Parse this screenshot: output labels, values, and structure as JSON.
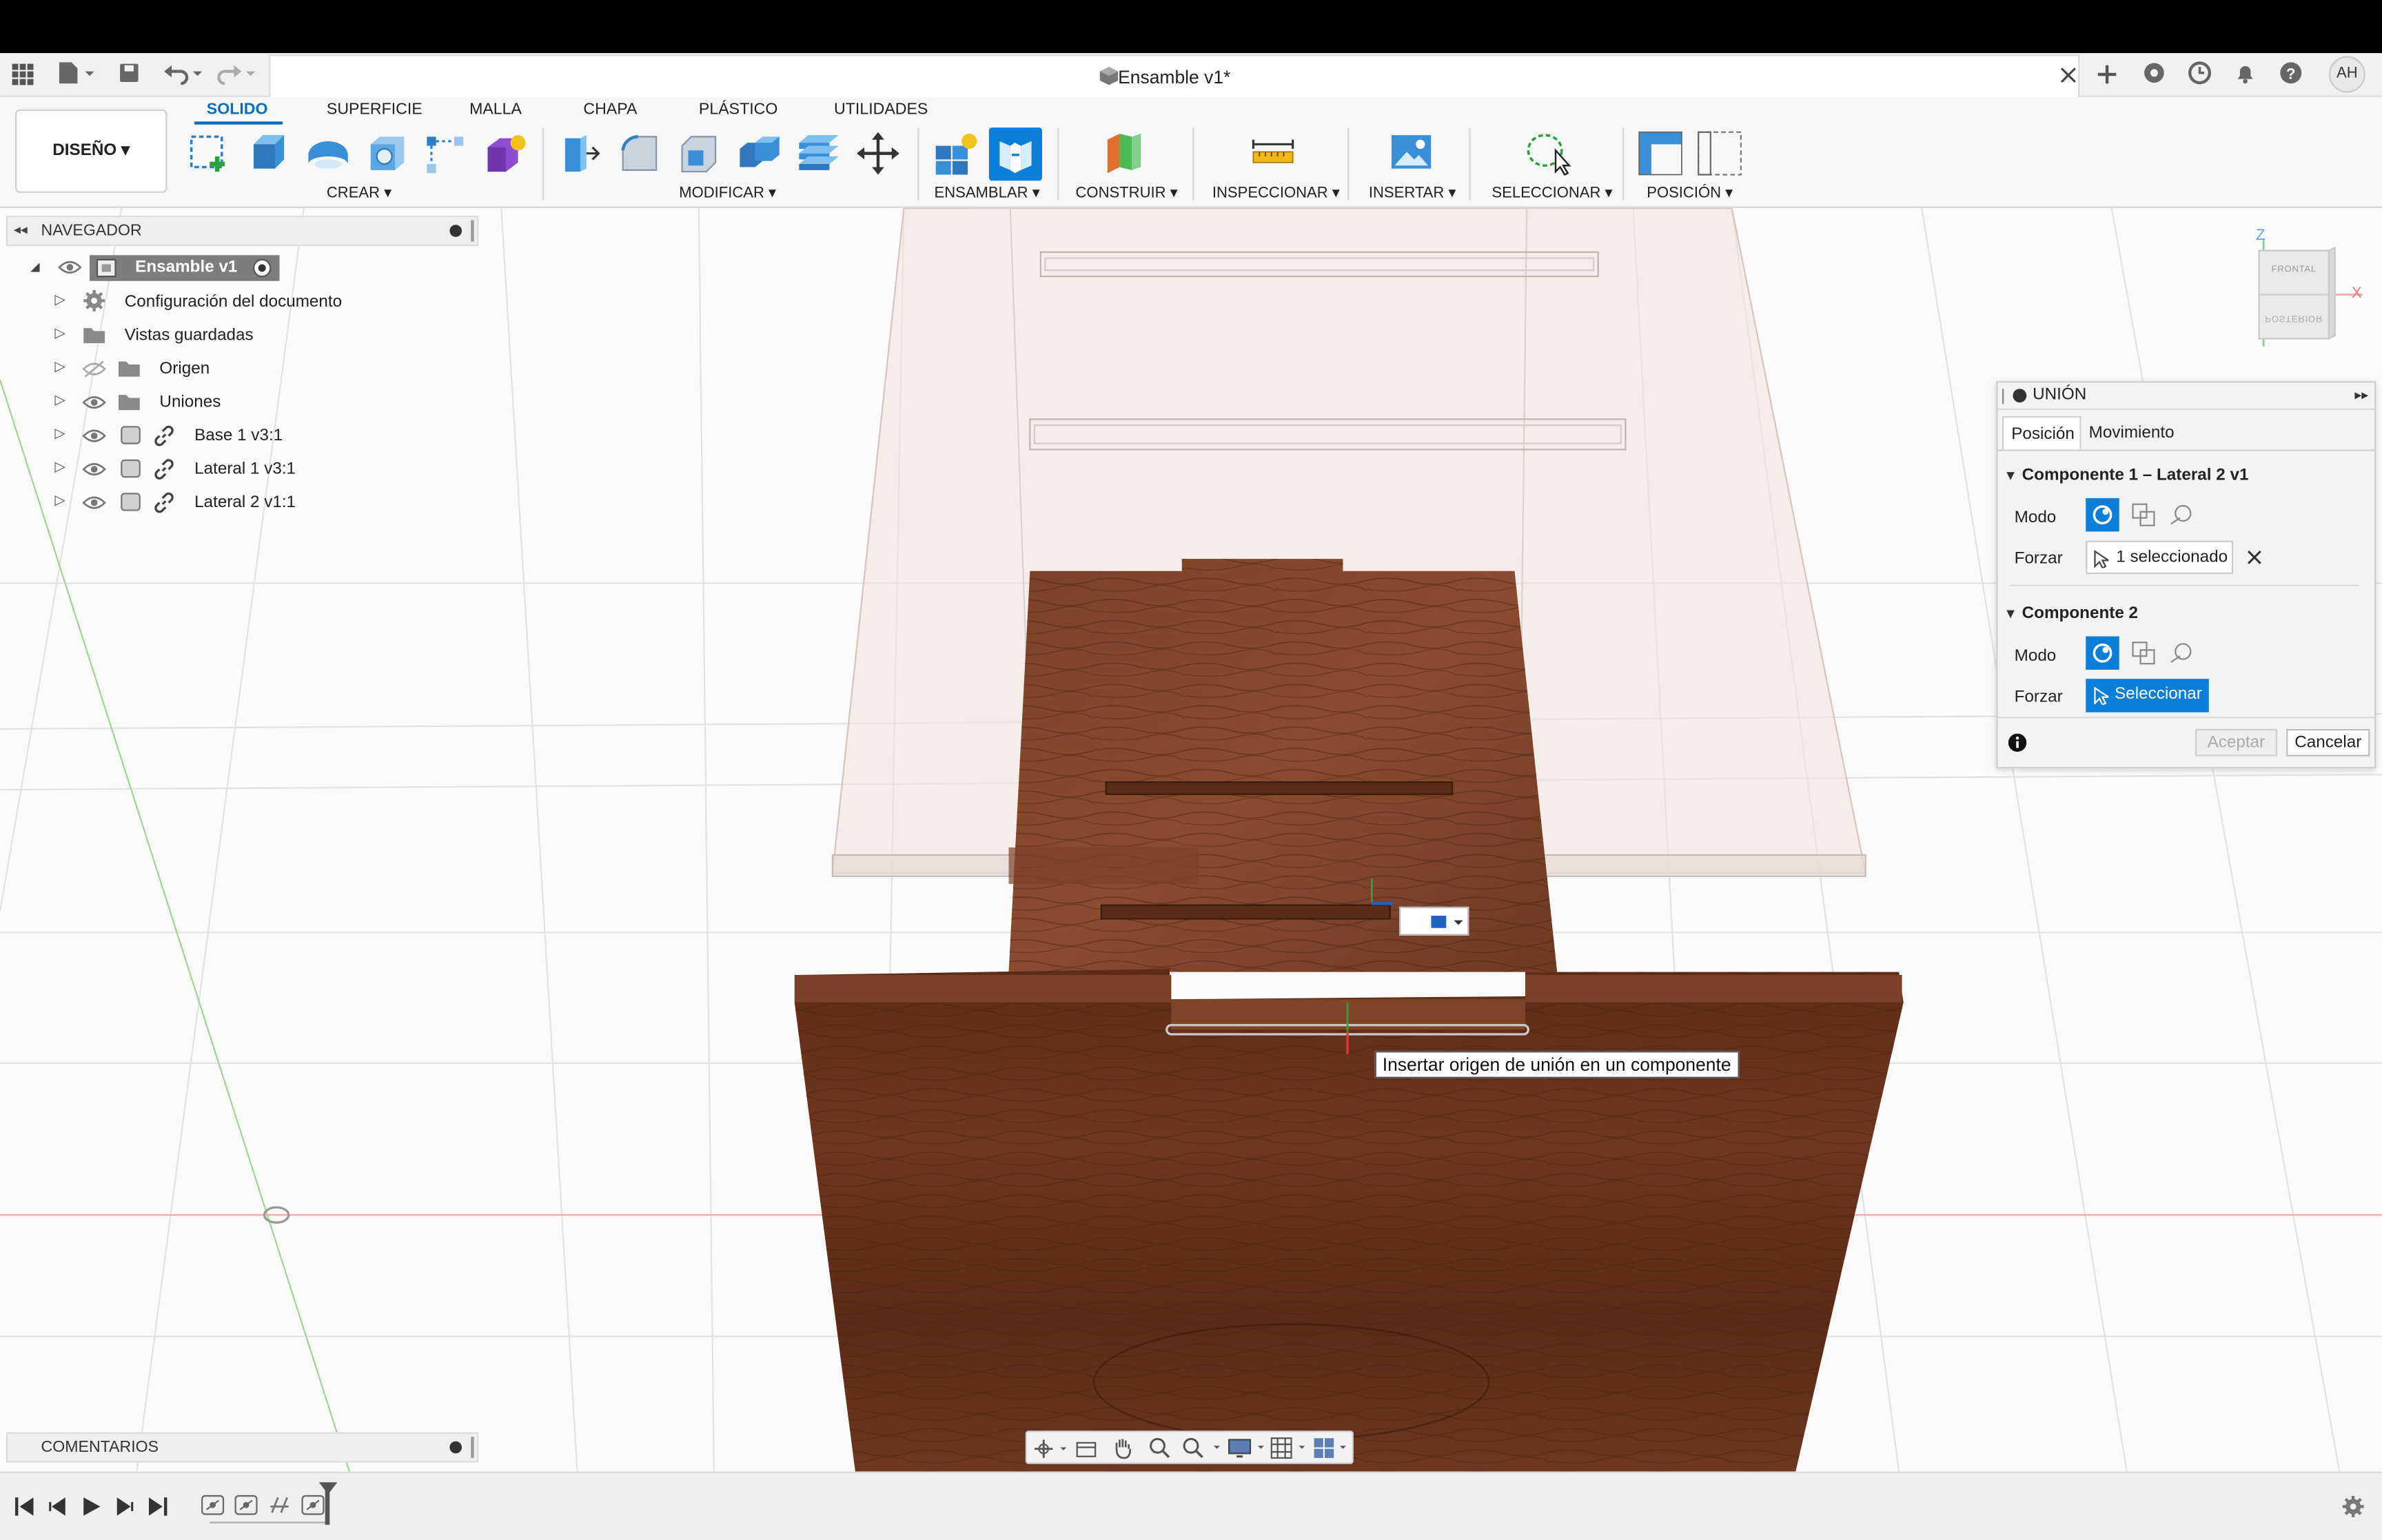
{
  "document": {
    "title": "Ensamble v1*"
  },
  "user": {
    "initials": "AH"
  },
  "workspace": {
    "label": "DISEÑO ▾"
  },
  "ribbon": {
    "tabs": [
      "SOLIDO",
      "SUPERFICIE",
      "MALLA",
      "CHAPA",
      "PLÁSTICO",
      "UTILIDADES"
    ],
    "active_tab": "SOLIDO",
    "groups": [
      "CREAR ▾",
      "MODIFICAR ▾",
      "ENSAMBLAR ▾",
      "CONSTRUIR ▾",
      "INSPECCIONAR ▾",
      "INSERTAR ▾",
      "SELECCIONAR ▾",
      "POSICIÓN ▾"
    ]
  },
  "navigator": {
    "title": "NAVEGADOR",
    "root": "Ensamble v1",
    "items": [
      {
        "label": "Configuración del documento",
        "icon": "gear-icon"
      },
      {
        "label": "Vistas guardadas",
        "icon": "folder-icon"
      },
      {
        "label": "Origen",
        "icon": "folder-icon"
      },
      {
        "label": "Uniones",
        "icon": "folder-icon"
      },
      {
        "label": "Base 1 v3:1",
        "icon": "component-icon"
      },
      {
        "label": "Lateral 1 v3:1",
        "icon": "component-icon"
      },
      {
        "label": "Lateral 2 v1:1",
        "icon": "component-icon"
      }
    ]
  },
  "comments": {
    "title": "COMENTARIOS"
  },
  "viewcube": {
    "front": "FRONTAL",
    "back": "POSTERIOR",
    "z": "Z",
    "x": "X"
  },
  "join_panel": {
    "title": "UNIÓN",
    "tabs": [
      "Posición",
      "Movimiento"
    ],
    "comp1_title": "Componente 1 – Lateral 2 v1",
    "comp2_title": "Componente 2",
    "mode_label": "Modo",
    "force_label": "Forzar",
    "comp1_selection": "1 seleccionado",
    "comp2_selection": "Seleccionar",
    "ok": "Aceptar",
    "cancel": "Cancelar"
  },
  "tooltip": {
    "text": "Insertar origen de unión en un componente"
  },
  "colors": {
    "accent": "#0a6fc2",
    "wood": "#6b3520",
    "wood_dark": "#4e2514",
    "selection": "#0a7ed8"
  }
}
